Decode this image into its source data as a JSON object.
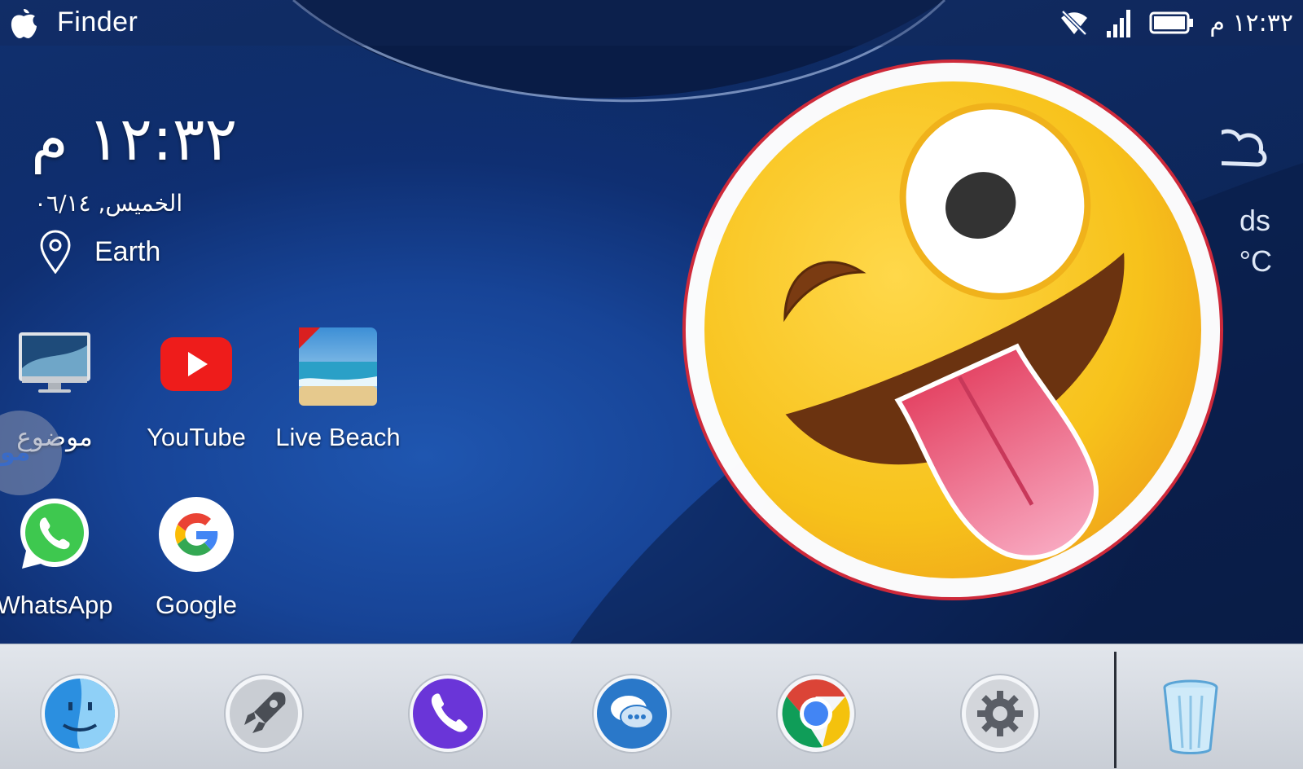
{
  "statusbar": {
    "app_name": "Finder",
    "time": "١٢:٣٢ م",
    "icons": [
      "apple-logo-icon",
      "wifi-off-icon",
      "signal-icon",
      "battery-icon"
    ]
  },
  "clock_widget": {
    "time": "١٢:٣٢ م",
    "date": "الخميس, ٠٦/١٤",
    "location": "Earth",
    "location_icon": "location-pin-icon"
  },
  "weather_widget": {
    "line1": "ds",
    "line2": "°C",
    "icon": "cloud-icon"
  },
  "apps": [
    {
      "label": "موضوع",
      "icon": "imac-icon"
    },
    {
      "label": "YouTube",
      "icon": "youtube-icon"
    },
    {
      "label": "Live Beach",
      "icon": "live-beach-icon"
    },
    {
      "label": "WhatsApp",
      "icon": "whatsapp-icon"
    },
    {
      "label": "Google",
      "icon": "google-icon"
    }
  ],
  "dock": {
    "items": [
      {
        "name": "finder",
        "icon": "finder-icon"
      },
      {
        "name": "launchpad",
        "icon": "rocket-icon"
      },
      {
        "name": "phone",
        "icon": "phone-icon"
      },
      {
        "name": "messages",
        "icon": "messages-icon"
      },
      {
        "name": "chrome",
        "icon": "chrome-icon"
      },
      {
        "name": "settings",
        "icon": "gear-icon"
      },
      {
        "name": "trash",
        "icon": "trash-icon"
      }
    ]
  },
  "overlay": {
    "emoji": "winking-tongue-emoji"
  },
  "colors": {
    "wallpaper": "#174497",
    "dock": "#d6dae0",
    "youtube_red": "#ee1c1b",
    "whatsapp_green": "#3ec84f",
    "emoji_yellow": "#f7c21b"
  }
}
